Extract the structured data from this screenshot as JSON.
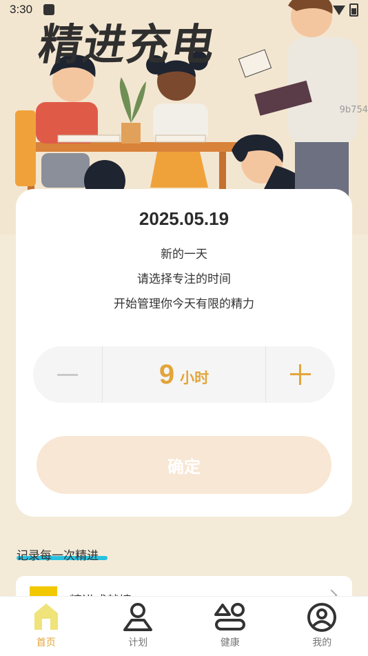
{
  "status_bar": {
    "time": "3:30"
  },
  "hero": {
    "title": "精进充电",
    "code": "9b754"
  },
  "card": {
    "date": "2025.05.19",
    "line1": "新的一天",
    "line2": "请选择专注的时间",
    "line3": "开始管理你今天有限的精力",
    "stepper": {
      "hours": "9",
      "unit": "小时"
    },
    "confirm_label": "确定"
  },
  "records": {
    "section_title": "记录每一次精进",
    "item_label": "精进成就墙"
  },
  "bottom_nav": [
    {
      "label": "首页",
      "icon": "home-icon",
      "active": true
    },
    {
      "label": "计划",
      "icon": "person-icon",
      "active": false
    },
    {
      "label": "健康",
      "icon": "health-icon",
      "active": false
    },
    {
      "label": "我的",
      "icon": "profile-icon",
      "active": false
    }
  ],
  "colors": {
    "accent": "#e3a53a",
    "background": "#f4ead8",
    "underline": "#27c1e0"
  }
}
